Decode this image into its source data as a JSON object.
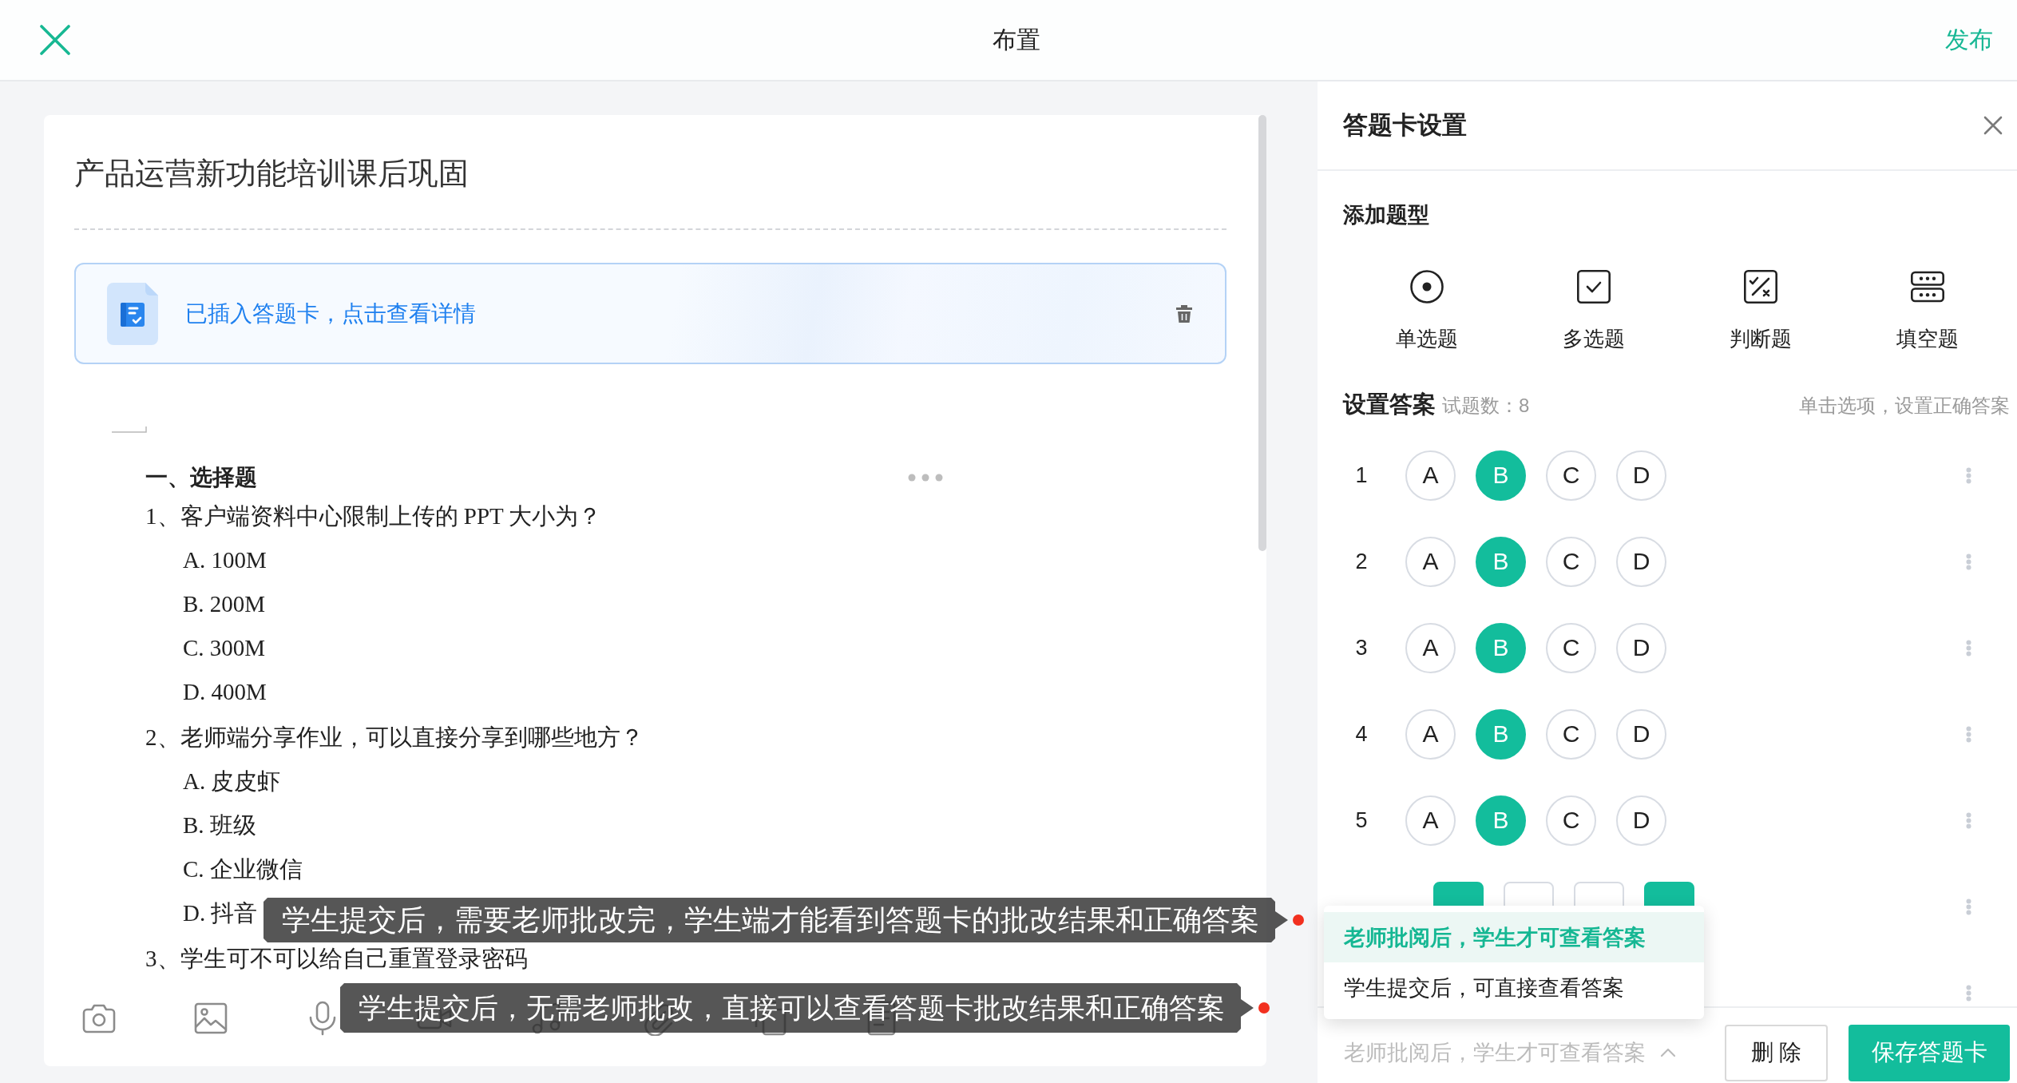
{
  "topbar": {
    "title": "布置",
    "action": "发布"
  },
  "document": {
    "title": "产品运营新功能培训课后巩固",
    "banner": {
      "text": "已插入答题卡，点击查看详情"
    },
    "section_title": "一、选择题",
    "questions": [
      {
        "text": "1、客户端资料中心限制上传的 PPT 大小为？",
        "options": [
          "A. 100M",
          "B. 200M",
          "C. 300M",
          "D. 400M"
        ]
      },
      {
        "text": "2、老师端分享作业，可以直接分享到哪些地方？",
        "options": [
          "A. 皮皮虾",
          "B. 班级",
          "C. 企业微信",
          "D. 抖音"
        ]
      },
      {
        "text": "3、学生可不可以给自己重置登录密码"
      }
    ]
  },
  "panel": {
    "title": "答题卡设置",
    "add_type_title": "添加题型",
    "question_types": [
      {
        "label": "单选题",
        "kind": "single"
      },
      {
        "label": "多选题",
        "kind": "multi"
      },
      {
        "label": "判断题",
        "kind": "judge"
      },
      {
        "label": "填空题",
        "kind": "blank"
      }
    ],
    "answers_title": "设置答案",
    "question_count": "试题数：8",
    "hint": "单击选项，设置正确答案",
    "rows": [
      {
        "number": "1",
        "kind": "single",
        "options": [
          {
            "label": "A",
            "selected": false
          },
          {
            "label": "B",
            "selected": true
          },
          {
            "label": "C",
            "selected": false
          },
          {
            "label": "D",
            "selected": false
          }
        ]
      },
      {
        "number": "2",
        "kind": "single",
        "options": [
          {
            "label": "A",
            "selected": false
          },
          {
            "label": "B",
            "selected": true
          },
          {
            "label": "C",
            "selected": false
          },
          {
            "label": "D",
            "selected": false
          }
        ]
      },
      {
        "number": "3",
        "kind": "single",
        "options": [
          {
            "label": "A",
            "selected": false
          },
          {
            "label": "B",
            "selected": true
          },
          {
            "label": "C",
            "selected": false
          },
          {
            "label": "D",
            "selected": false
          }
        ]
      },
      {
        "number": "4",
        "kind": "single",
        "options": [
          {
            "label": "A",
            "selected": false
          },
          {
            "label": "B",
            "selected": true
          },
          {
            "label": "C",
            "selected": false
          },
          {
            "label": "D",
            "selected": false
          }
        ]
      },
      {
        "number": "5",
        "kind": "single",
        "options": [
          {
            "label": "A",
            "selected": false
          },
          {
            "label": "B",
            "selected": true
          },
          {
            "label": "C",
            "selected": false
          },
          {
            "label": "D",
            "selected": false
          }
        ]
      },
      {
        "kind": "multi",
        "options": [
          {
            "selected": true
          },
          {
            "selected": false
          },
          {
            "selected": false
          },
          {
            "selected": true
          }
        ]
      },
      {}
    ],
    "visibility_select": {
      "value": "老师批阅后，学生才可查看答案",
      "expanded": true,
      "options": [
        {
          "label": "老师批阅后，学生才可查看答案",
          "selected": true
        },
        {
          "label": "学生提交后，可直接查看答案",
          "selected": false
        }
      ]
    },
    "buttons": [
      {
        "label": "删 除",
        "kind": "delete"
      },
      {
        "label": "保存答题卡",
        "kind": "save"
      }
    ]
  },
  "annotations": [
    {
      "text": "学生提交后，需要老师批改完，学生端才能看到答题卡的批改结果和正确答案"
    },
    {
      "text": "学生提交后，无需老师批改，直接可以查看答题卡批改结果和正确答案"
    }
  ]
}
